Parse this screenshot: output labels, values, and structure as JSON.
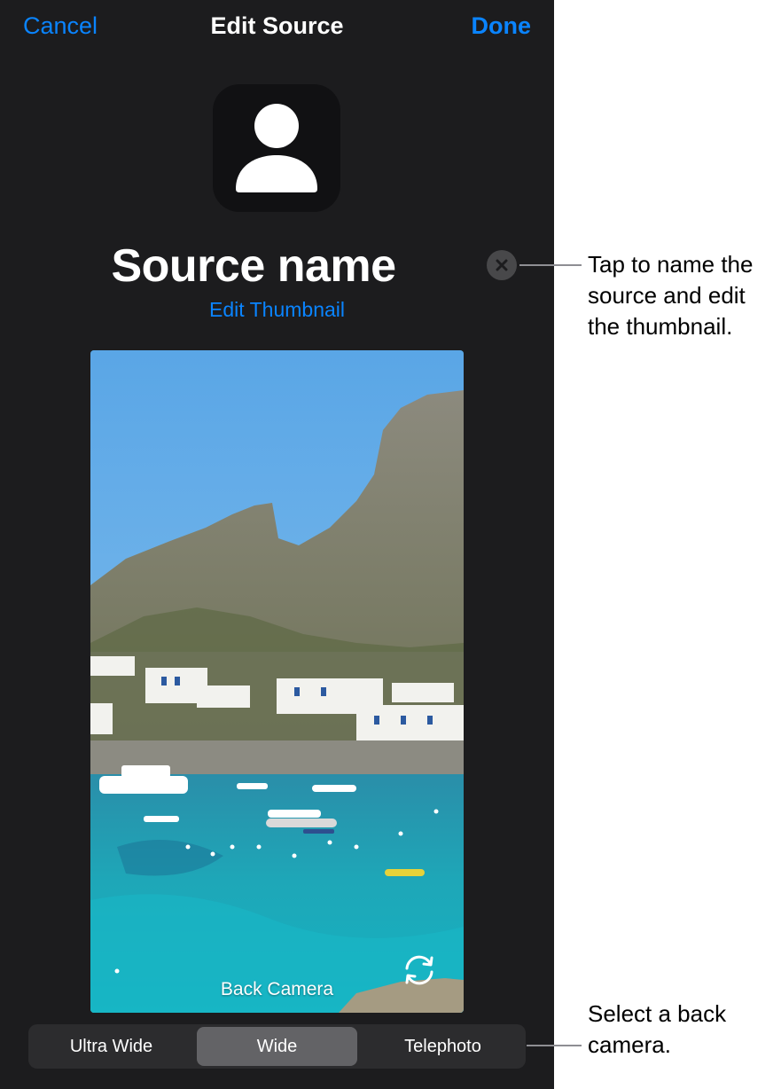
{
  "nav": {
    "cancel_label": "Cancel",
    "title": "Edit Source",
    "done_label": "Done"
  },
  "thumbnail": {
    "icon": "person-icon"
  },
  "source": {
    "name": "Source name",
    "clear_icon": "clear-icon",
    "edit_thumbnail_label": "Edit Thumbnail"
  },
  "preview": {
    "camera_label": "Back Camera",
    "flip_icon": "camera-flip-icon"
  },
  "lens_selector": {
    "options": [
      "Ultra Wide",
      "Wide",
      "Telephoto"
    ],
    "selected": "Wide"
  },
  "callouts": [
    {
      "text": "Tap to name the source and edit the thumbnail."
    },
    {
      "text": "Select a back camera."
    }
  ],
  "colors": {
    "accent": "#0a84ff",
    "background": "#1c1c1e",
    "segment_selected": "#636366"
  }
}
